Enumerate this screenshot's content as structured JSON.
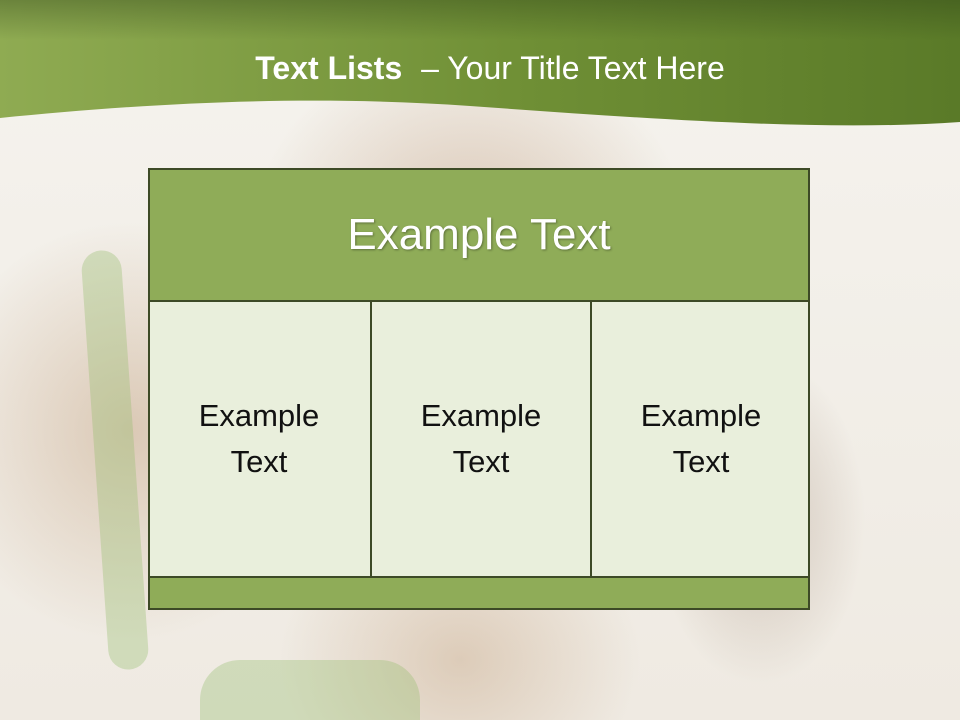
{
  "slide": {
    "title_bold": "Text Lists",
    "title_separator": "–",
    "title_rest": "Your Title Text Here"
  },
  "table": {
    "header": "Example Text",
    "cells": [
      "Example Text",
      "Example Text",
      "Example Text"
    ]
  },
  "colors": {
    "banner_green": "#7a9a3e",
    "header_fill": "#8fac58",
    "cell_fill": "#e9efdc",
    "border": "#3d4a26"
  }
}
